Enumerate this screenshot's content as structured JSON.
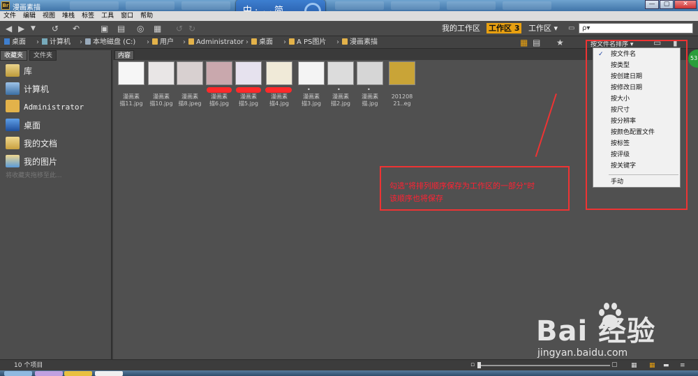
{
  "window": {
    "title": "漫画素描",
    "controls": [
      "—",
      "▢",
      "✕"
    ]
  },
  "ime": {
    "text": "中 ·, ◡ 简"
  },
  "menu": [
    "文件",
    "编辑",
    "视图",
    "堆栈",
    "标签",
    "工具",
    "窗口",
    "帮助"
  ],
  "toolbar": {
    "workspace_mine": "我的工作区",
    "workspace_3": "工作区 3",
    "workspace_other": "工作区 ▾",
    "search_placeholder": "ρ▾"
  },
  "path": {
    "items": [
      "桌面",
      "计算机",
      "本地磁盘 (C:)",
      "用户",
      "Administrator",
      "桌面",
      "A PS图片",
      "漫画素描"
    ],
    "sort_button": "按文件名排序 ▾"
  },
  "left_panel": {
    "tabs": [
      "收藏夹",
      "文件夹"
    ],
    "favorites": [
      "库",
      "计算机",
      "Administrator",
      "桌面",
      "我的文档",
      "我的图片"
    ],
    "hint": "将收藏夹拖移至此..."
  },
  "content": {
    "tab": "内容",
    "thumbnails": [
      {
        "line1": "漫画素",
        "line2": "描11.jpg",
        "color": "#f6f6f6"
      },
      {
        "line1": "漫画素",
        "line2": "描10.jpg",
        "color": "#e9e6e6"
      },
      {
        "line1": "漫画素",
        "line2": "描8.jpeg",
        "color": "#d8d0d0"
      },
      {
        "line1": "漫画素",
        "line2": "描6.jpg",
        "color": "#c9a8ad"
      },
      {
        "line1": "漫画素",
        "line2": "描5.jpg",
        "color": "#e6e2ee"
      },
      {
        "line1": "漫画素",
        "line2": "描4.jpg",
        "color": "#f0ead8"
      },
      {
        "line1": "漫画素",
        "line2": "描3.jpg",
        "color": "#f4f4f4"
      },
      {
        "line1": "漫画素",
        "line2": "描2.jpg",
        "color": "#dcdcdc"
      },
      {
        "line1": "漫画素",
        "line2": "描.jpg",
        "color": "#d6d6d6"
      },
      {
        "line1": "201208",
        "line2": "21..eg",
        "color": "#c9a437"
      }
    ]
  },
  "sort_menu": {
    "items": [
      "按文件名",
      "按类型",
      "按创建日期",
      "按修改日期",
      "按大小",
      "按尺寸",
      "按分辨率",
      "按颜色配置文件",
      "按标签",
      "按评级",
      "按关键字"
    ],
    "checked": "✓",
    "manual": "手动"
  },
  "annotation": {
    "line1": "勾选\"将排列顺序保存为工作区的一部分\"时",
    "line2": "该顺序也将保存"
  },
  "badge": "53",
  "status": {
    "count": "10 个项目"
  },
  "watermark": {
    "brand": "Bai 经验",
    "url": "jingyan.baidu.com"
  },
  "colors": {
    "workspace_active": "#e8a010",
    "annotation_red": "#ee3333"
  }
}
